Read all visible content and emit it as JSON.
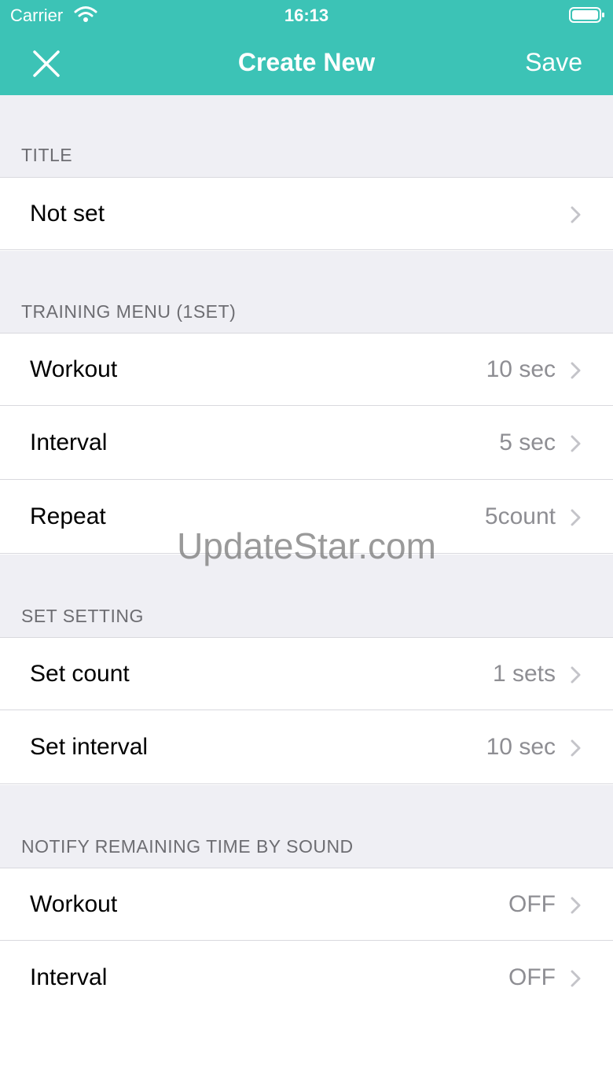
{
  "status_bar": {
    "carrier": "Carrier",
    "time": "16:13"
  },
  "nav": {
    "close_icon": "close-icon",
    "title": "Create New",
    "save_label": "Save"
  },
  "sections": {
    "title": {
      "header": "TITLE",
      "rows": [
        {
          "label": "Not set",
          "value": ""
        }
      ]
    },
    "training_menu": {
      "header": "TRAINING MENU (1SET)",
      "rows": [
        {
          "label": "Workout",
          "value": "10 sec"
        },
        {
          "label": "Interval",
          "value": "5 sec"
        },
        {
          "label": "Repeat",
          "value": "5count"
        }
      ]
    },
    "set_setting": {
      "header": "SET SETTING",
      "rows": [
        {
          "label": "Set count",
          "value": "1 sets"
        },
        {
          "label": "Set interval",
          "value": "10 sec"
        }
      ]
    },
    "notify": {
      "header": "NOTIFY REMAINING TIME BY SOUND",
      "rows": [
        {
          "label": "Workout",
          "value": "OFF"
        },
        {
          "label": "Interval",
          "value": "OFF"
        }
      ]
    }
  },
  "watermark": "UpdateStar.com",
  "colors": {
    "accent": "#3cc3b6",
    "group_background": "#efeff4",
    "secondary_text": "#8e8e93"
  }
}
